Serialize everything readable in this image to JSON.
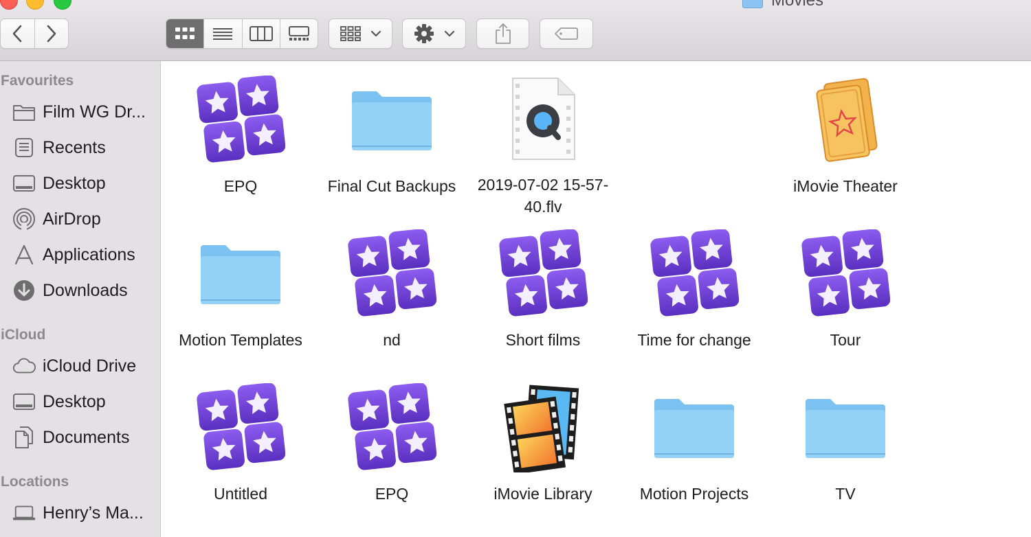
{
  "window": {
    "title": "Movies"
  },
  "toolbar": {
    "view_modes": [
      "icon-view",
      "list-view",
      "column-view",
      "gallery-view"
    ],
    "active_view": "icon-view"
  },
  "sidebar": {
    "favourites_heading": "Favourites",
    "favourites": [
      {
        "label": "Film WG Dr...",
        "icon": "folder-icon"
      },
      {
        "label": "Recents",
        "icon": "recents-icon"
      },
      {
        "label": "Desktop",
        "icon": "desktop-icon"
      },
      {
        "label": "AirDrop",
        "icon": "airdrop-icon"
      },
      {
        "label": "Applications",
        "icon": "applications-icon"
      },
      {
        "label": "Downloads",
        "icon": "downloads-icon"
      }
    ],
    "icloud_heading": "iCloud",
    "icloud": [
      {
        "label": "iCloud Drive",
        "icon": "cloud-icon"
      },
      {
        "label": "Desktop",
        "icon": "desktop-icon"
      },
      {
        "label": "Documents",
        "icon": "documents-icon"
      }
    ],
    "locations_heading": "Locations",
    "locations": [
      {
        "label": "Henry’s Ma...",
        "icon": "laptop-icon"
      }
    ]
  },
  "files": [
    {
      "name": "EPQ",
      "icon": "imovie-project-icon"
    },
    {
      "name": "Final Cut Backups",
      "icon": "folder-icon"
    },
    {
      "name": "2019-07-02 15-57-40.flv",
      "icon": "quicktime-file-icon"
    },
    {
      "name": "",
      "icon": ""
    },
    {
      "name": "iMovie Theater",
      "icon": "imovie-theater-icon"
    },
    {
      "name": "Motion Templates",
      "icon": "folder-icon"
    },
    {
      "name": "nd",
      "icon": "imovie-project-icon"
    },
    {
      "name": "Short films",
      "icon": "imovie-project-icon"
    },
    {
      "name": "Time for change",
      "icon": "imovie-project-icon"
    },
    {
      "name": "Tour",
      "icon": "imovie-project-icon"
    },
    {
      "name": "Untitled",
      "icon": "imovie-project-icon"
    },
    {
      "name": "EPQ",
      "icon": "imovie-project-icon"
    },
    {
      "name": "iMovie Library",
      "icon": "imovie-library-icon"
    },
    {
      "name": "Motion Projects",
      "icon": "folder-icon"
    },
    {
      "name": "TV",
      "icon": "folder-icon"
    }
  ],
  "colors": {
    "folder": "#8ecdf5",
    "imovie_purple": "#6b3fd1",
    "active_segment": "#6e6e6e"
  }
}
